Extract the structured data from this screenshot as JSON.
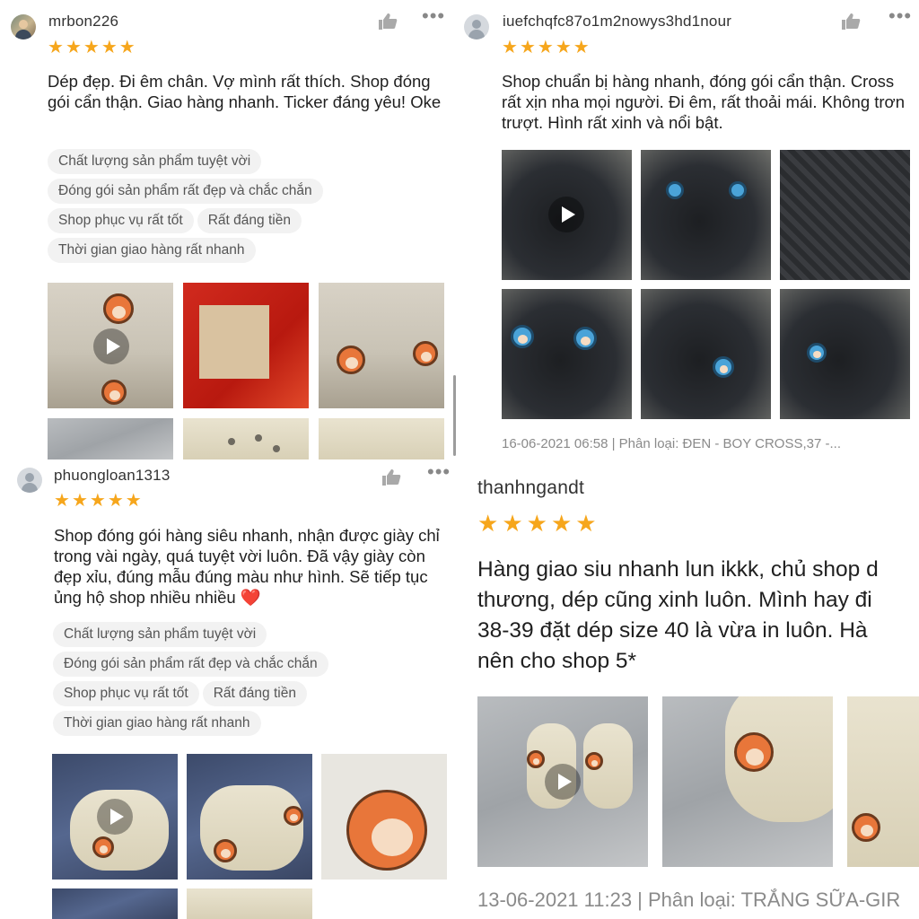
{
  "panels": [
    {
      "username": "mrbon226",
      "rating": 5,
      "review": "Dép đẹp. Đi êm chân. Vợ mình rất thích. Shop đóng gói cẩn thận. Giao hàng nhanh. Ticker đáng yêu! Oke",
      "tags": [
        "Chất lượng sản phẩm tuyệt vời",
        "Đóng gói sản phẩm rất đẹp và chắc chắn",
        "Shop phục vụ rất tốt",
        "Rất đáng tiền",
        "Thời gian giao hàng rất nhanh"
      ]
    },
    {
      "username": "iuefchqfc87o1m2nowys3hd1nour",
      "rating": 5,
      "review": "Shop chuẩn bị hàng nhanh, đóng gói cẩn thận. Cross rất xịn nha mọi người. Đi êm, rất thoải mái. Không trơn trượt. Hình rất xinh và nổi bật.",
      "meta": "16-06-2021 06:58 | Phân loại: ĐEN - BOY CROSS,37 -..."
    },
    {
      "username": "phuongloan1313",
      "rating": 5,
      "review": "Shop đóng gói hàng siêu nhanh, nhận được giày chỉ trong vài ngày, quá tuyệt vời luôn. Đã vậy giày còn đẹp xỉu, đúng mẫu đúng màu như hình. Sẽ tiếp tục ủng hộ shop nhiều nhiều ❤️",
      "tags": [
        "Chất lượng sản phẩm tuyệt vời",
        "Đóng gói sản phẩm rất đẹp và chắc chắn",
        "Shop phục vụ rất tốt",
        "Rất đáng tiền",
        "Thời gian giao hàng rất nhanh"
      ]
    },
    {
      "username": "thanhngandt",
      "rating": 5,
      "review_lines": [
        "Hàng giao siu nhanh lun ikkk, chủ shop d",
        "thương, dép cũng xinh luôn. Mình hay đi",
        "38-39 đặt dép size 40 là vừa in luôn. Hà",
        "nên cho shop 5*"
      ],
      "meta": "13-06-2021 11:23 | Phân loại: TRẮNG SỮA-GIR"
    }
  ],
  "icons": {
    "like": "thumbs-up-icon",
    "more": "more-options-icon",
    "play": "play-icon",
    "star": "star-icon"
  },
  "colors": {
    "star": "#f6a61c",
    "tag_bg": "#f2f2f2",
    "meta_text": "#8a8a8a"
  }
}
